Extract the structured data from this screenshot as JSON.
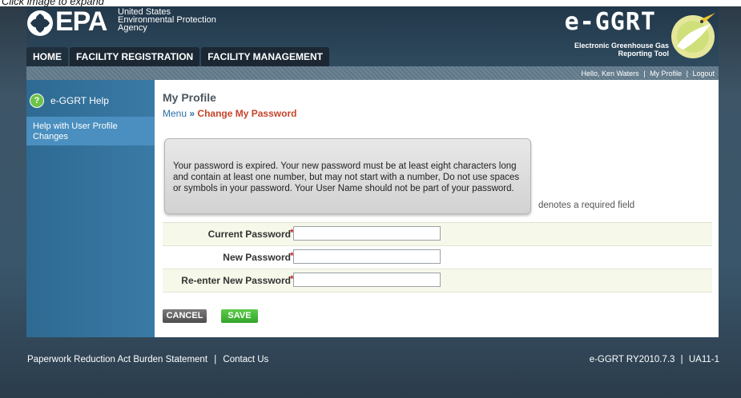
{
  "caption": "Click image to expand",
  "header": {
    "epa_wordmark": "EPA",
    "epa_agency_lines": [
      "United States",
      "Environmental Protection",
      "Agency"
    ],
    "app_title": "e-GGRT",
    "app_subtitle_lines": [
      "Electronic Greenhouse Gas",
      "Reporting Tool"
    ],
    "nav_tabs": [
      "HOME",
      "FACILITY REGISTRATION",
      "FACILITY MANAGEMENT"
    ]
  },
  "userbar": {
    "greeting": "Hello, Ken Waters",
    "my_profile": "My Profile",
    "logout": "Logout",
    "separator": "|"
  },
  "sidebar": {
    "help_title": "e-GGRT Help",
    "help_item": "Help with User Profile Changes"
  },
  "main": {
    "page_title": "My Profile",
    "breadcrumb_menu": "Menu",
    "breadcrumb_separator": "»",
    "breadcrumb_current": "Change My Password",
    "notice": "Your password is expired. Your new password must be at least eight characters long and contain at least one number, but may not start with a number, Do not use spaces or symbols in your password. Your User Name should not be part of your password.",
    "required_note": "denotes a required field",
    "fields": [
      {
        "label": "Current Password",
        "value": ""
      },
      {
        "label": "New Password",
        "value": ""
      },
      {
        "label": "Re-enter New Password",
        "value": ""
      }
    ],
    "required_marker": "*",
    "cancel_label": "CANCEL",
    "save_label": "SAVE"
  },
  "footer": {
    "paperwork": "Paperwork Reduction Act Burden Statement",
    "contact": "Contact Us",
    "separator": "|",
    "version": "e-GGRT RY2010.7.3",
    "screen_id": "UA11-1"
  },
  "colors": {
    "header_bg": "#22384a",
    "sidebar_bg": "#2e6a92",
    "breadcrumb_current": "#c5432b",
    "save_green": "#32a52a",
    "required_red": "#c62828"
  }
}
